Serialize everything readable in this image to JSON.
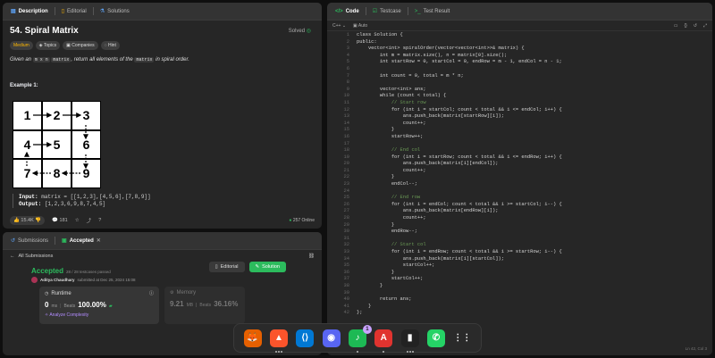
{
  "left_tabs": {
    "description": "Description",
    "editorial": "Editorial",
    "solutions": "Solutions"
  },
  "problem": {
    "title": "54. Spiral Matrix",
    "status": "Solved",
    "difficulty": "Medium",
    "chips": [
      "Topics",
      "Companies",
      "Hint"
    ],
    "statement_pre": "Given an",
    "statement_code1": "m x n",
    "statement_code2": "matrix",
    "statement_mid": ", return all elements of the",
    "statement_code3": "matrix",
    "statement_post": "in spiral order.",
    "example_label": "Example 1:",
    "grid": [
      "1",
      "2",
      "3",
      "4",
      "5",
      "6",
      "7",
      "8",
      "9"
    ],
    "input_label": "Input:",
    "input_value": "matrix = [[1,2,3],[4,5,6],[7,8,9]]",
    "output_label": "Output:",
    "output_value": "[1,2,3,6,9,8,7,4,5]"
  },
  "desc_footer": {
    "likes": "15.4K",
    "comments": "181",
    "online": "257 Online"
  },
  "sub_tabs": {
    "submissions": "Submissions",
    "accepted": "Accepted"
  },
  "submission": {
    "all": "All Submissions",
    "result": "Accepted",
    "passed": "28 / 28 testcases passed",
    "author": "Aditya Chaudhary",
    "submitted": "submitted at Dec 25, 2024 15:08",
    "editorial_btn": "Editorial",
    "solution_btn": "Solution",
    "runtime_label": "Runtime",
    "runtime_value": "0",
    "runtime_unit": "ms",
    "beats_label": "Beats",
    "beats_value": "100.00%",
    "analyze": "Analyze Complexity",
    "memory_label": "Memory",
    "memory_value": "9.21",
    "memory_unit": "MB",
    "mem_beats_label": "Beats",
    "mem_beats_value": "36.16%"
  },
  "editor": {
    "tabs": {
      "code": "Code",
      "testcase": "Testcase",
      "result": "Test Result"
    },
    "lang": "C++",
    "mode": "Auto",
    "status": "Ln 42, Col 3",
    "lines": [
      "class Solution {",
      "public:",
      "    vector<int> spiralOrder(vector<vector<int>>& matrix) {",
      "        int m = matrix.size(), n = matrix[0].size();",
      "        int startRow = 0, startCol = 0, endRow = m - 1, endCol = n - 1;",
      "",
      "        int count = 0, total = m * n;",
      "",
      "        vector<int> ans;",
      "        while (count < total) {",
      "            // Start row",
      "            for (int i = startCol; count < total && i <= endCol; i++) {",
      "                ans.push_back(matrix[startRow][i]);",
      "                count++;",
      "            }",
      "            startRow++;",
      "",
      "            // End col",
      "            for (int i = startRow; count < total && i <= endRow; i++) {",
      "                ans.push_back(matrix[i][endCol]);",
      "                count++;",
      "            }",
      "            endCol--;",
      "",
      "            // End row",
      "            for (int i = endCol; count < total && i >= startCol; i--) {",
      "                ans.push_back(matrix[endRow][i]);",
      "                count++;",
      "            }",
      "            endRow--;",
      "",
      "            // Start col",
      "            for (int i = endRow; count < total && i >= startRow; i--) {",
      "                ans.push_back(matrix[i][startCol]);",
      "                startCol++;",
      "            }",
      "            startCol++;",
      "        }",
      "",
      "        return ans;",
      "    }",
      "};"
    ]
  },
  "dock": {
    "apps": [
      {
        "name": "Firefox",
        "glyph": "🦊",
        "color": "#e66000",
        "dots": 0
      },
      {
        "name": "Brave",
        "glyph": "▲",
        "color": "#fb542b",
        "dots": 3
      },
      {
        "name": "VS Code",
        "glyph": "⟨⟩",
        "color": "#0078d4",
        "dots": 0
      },
      {
        "name": "Discord",
        "glyph": "◉",
        "color": "#5865f2",
        "dots": 0
      },
      {
        "name": "Spotify",
        "glyph": "♪",
        "color": "#1db954",
        "dots": 1,
        "badge": "1"
      },
      {
        "name": "PDF",
        "glyph": "A",
        "color": "#e0332f",
        "dots": 1
      },
      {
        "name": "Terminal",
        "glyph": "▮",
        "color": "#222",
        "dots": 3
      },
      {
        "name": "WhatsApp",
        "glyph": "✆",
        "color": "#25d366",
        "dots": 0
      },
      {
        "name": "Apps",
        "glyph": "⋮⋮",
        "color": "transparent",
        "dots": 0
      }
    ]
  }
}
